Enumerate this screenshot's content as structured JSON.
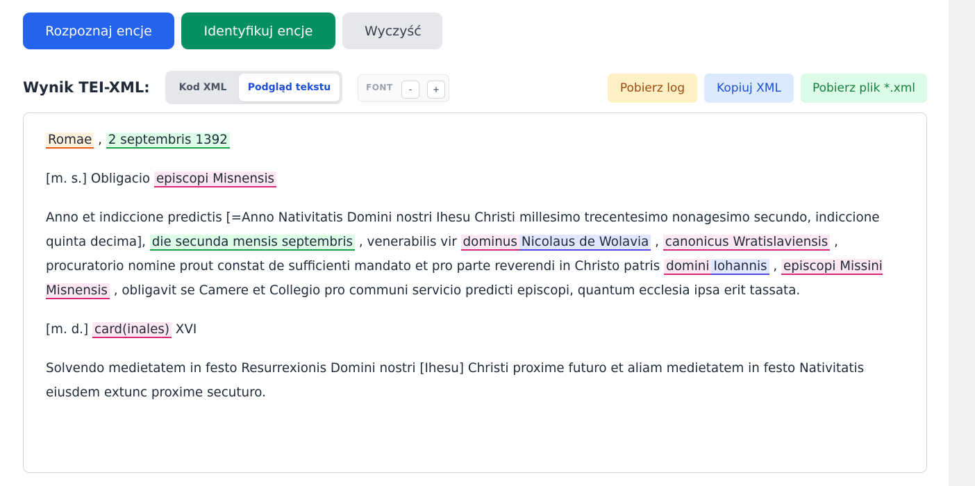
{
  "toolbar": {
    "recognize_label": "Rozpoznaj encje",
    "identify_label": "Identyfikuj encje",
    "clear_label": "Wyczyść"
  },
  "result": {
    "label": "Wynik TEI-XML:",
    "view_xml_label": "Kod XML",
    "view_preview_label": "Podgląd tekstu",
    "active_view": "Podgląd tekstu",
    "font_label": "FONT",
    "font_decrease": "-",
    "font_increase": "+",
    "download_log_label": "Pobierz log",
    "copy_xml_label": "Kopiuj XML",
    "download_xml_label": "Pobierz plik *.xml"
  },
  "preview": {
    "p1": {
      "place": "Romae",
      "sep": ",",
      "date": "2 septembris 1392"
    },
    "p2": {
      "t1": "[m. s.] Obligacio",
      "role": "episcopi Misnensis"
    },
    "p3": {
      "t1": "Anno et indiccione predictis [=Anno Nativitatis Domini nostri Ihesu Christi millesimo trecentesimo nonagesimo secundo, indiccione quinta decima],",
      "date": "die secunda mensis septembris",
      "t2": ", venerabilis vir",
      "role1": "dominus",
      "pers1": "Nicolaus de Wolavia",
      "sep1": ",",
      "role2": "canonicus Wratislaviensis",
      "t3": ", procuratorio nomine prout constat de sufficienti mandato et pro parte reverendi in Christo patris",
      "role3": "domini",
      "pers2": "Iohannis",
      "sep2": ",",
      "role4": "episcopi Missini Misnensis",
      "t4": ", obligavit se Camere et Collegio pro communi servicio predicti episcopi, quantum ecclesia ipsa erit tassata."
    },
    "p4": {
      "t1": "[m. d.]",
      "role": "card(inales)",
      "t2": "XVI"
    },
    "p5": {
      "t1": "Solvendo medietatem in festo Resurrexionis Domini nostri [Ihesu] Christi proxime futuro et aliam medietatem in festo Nativitatis eiusdem extunc proxime secuturo."
    }
  },
  "colors": {
    "primary": "#2463eb",
    "success": "#05905f",
    "place_entity": "#ea580c",
    "date_entity": "#16a34a",
    "role_entity": "#db2777",
    "person_entity": "#4f46e5"
  }
}
